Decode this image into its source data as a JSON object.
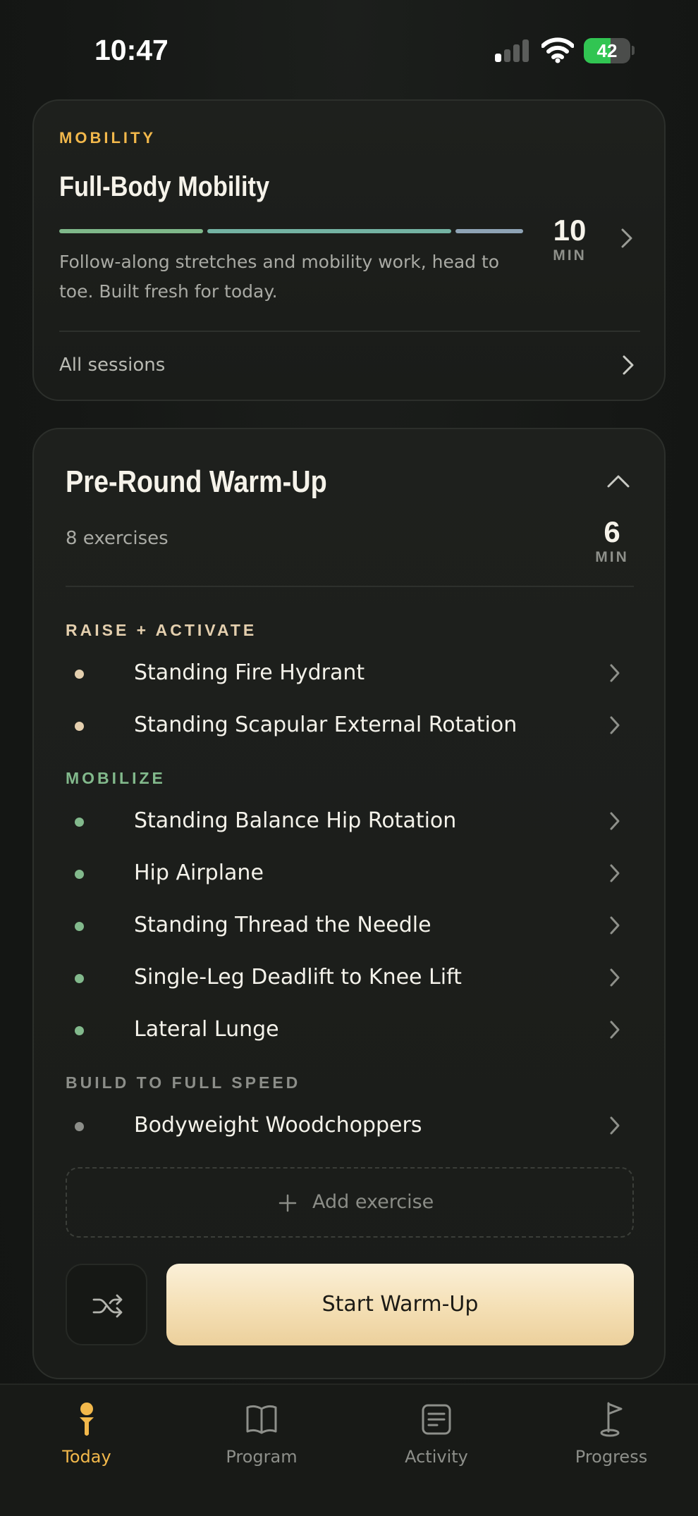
{
  "status_bar": {
    "time": "10:47",
    "battery": "42"
  },
  "mobility_card": {
    "eyebrow": "MOBILITY",
    "title": "Full-Body Mobility",
    "description_line1": "Follow-along stretches and mobility work, head to",
    "description_line2": "toe. Built fresh for today.",
    "duration_value": "10",
    "duration_unit": "MIN",
    "all_sessions_label": "All sessions",
    "segment_colors": [
      "#7fb88a",
      "#74b3a3",
      "#8ea3b5"
    ]
  },
  "warmup_card": {
    "title": "Pre-Round Warm-Up",
    "exercise_count": "8 exercises",
    "duration_value": "6",
    "duration_unit": "MIN",
    "sections": [
      {
        "label": "RAISE + ACTIVATE",
        "color": "#e4cfae",
        "exercises": [
          "Standing Fire Hydrant",
          "Standing Scapular External Rotation"
        ]
      },
      {
        "label": "MOBILIZE",
        "color": "#82b98c",
        "exercises": [
          "Standing Balance Hip Rotation",
          "Hip Airplane",
          "Standing Thread the Needle",
          "Single-Leg Deadlift to Knee Lift",
          "Lateral Lunge"
        ]
      },
      {
        "label": "BUILD TO FULL SPEED",
        "color": "#8c8e89",
        "exercises": [
          "Bodyweight Woodchoppers"
        ]
      }
    ],
    "add_exercise_label": "Add exercise",
    "start_label": "Start Warm-Up"
  },
  "tab_bar": {
    "active_color": "#f2b84b",
    "inactive_color": "#8d8f8a",
    "tabs": [
      {
        "label": "Today",
        "icon": "golf-tee-icon",
        "active": true
      },
      {
        "label": "Program",
        "icon": "book-icon",
        "active": false
      },
      {
        "label": "Activity",
        "icon": "activity-list-icon",
        "active": false
      },
      {
        "label": "Progress",
        "icon": "golf-flag-icon",
        "active": false
      }
    ]
  },
  "colors": {
    "accent_orange": "#f2b84b",
    "start_button": "#f4dfb4",
    "card_bg": "#1c1e1b"
  }
}
